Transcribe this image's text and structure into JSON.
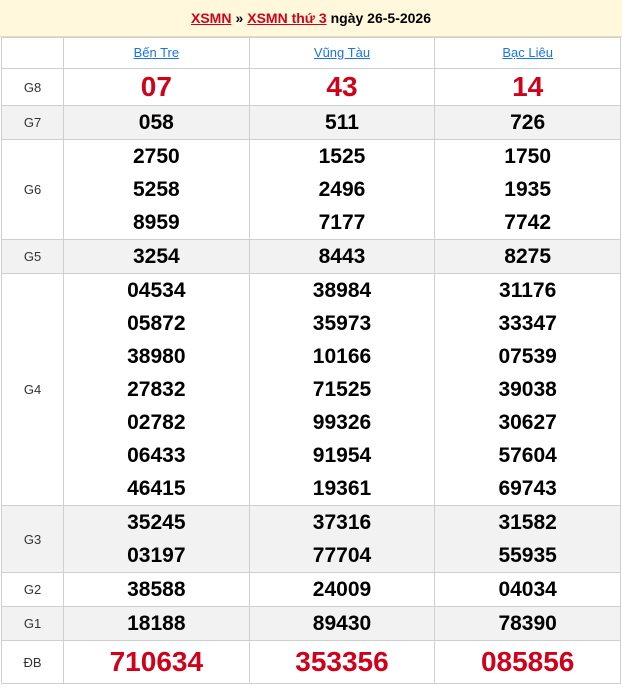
{
  "header": {
    "link1": "XSMN",
    "separator": "»",
    "link2": "XSMN thứ 3",
    "date_text": "ngày 26-5-2026"
  },
  "columns": [
    "Bến Tre",
    "Vũng Tàu",
    "Bạc Liêu"
  ],
  "prizes": [
    {
      "label": "G8",
      "values": [
        [
          "07"
        ],
        [
          "43"
        ],
        [
          "14"
        ]
      ]
    },
    {
      "label": "G7",
      "values": [
        [
          "058"
        ],
        [
          "511"
        ],
        [
          "726"
        ]
      ]
    },
    {
      "label": "G6",
      "values": [
        [
          "2750",
          "5258",
          "8959"
        ],
        [
          "1525",
          "2496",
          "7177"
        ],
        [
          "1750",
          "1935",
          "7742"
        ]
      ]
    },
    {
      "label": "G5",
      "values": [
        [
          "3254"
        ],
        [
          "8443"
        ],
        [
          "8275"
        ]
      ]
    },
    {
      "label": "G4",
      "values": [
        [
          "04534",
          "05872",
          "38980",
          "27832",
          "02782",
          "06433",
          "46415"
        ],
        [
          "38984",
          "35973",
          "10166",
          "71525",
          "99326",
          "91954",
          "19361"
        ],
        [
          "31176",
          "33347",
          "07539",
          "39038",
          "30627",
          "57604",
          "69743"
        ]
      ]
    },
    {
      "label": "G3",
      "values": [
        [
          "35245",
          "03197"
        ],
        [
          "37316",
          "77704"
        ],
        [
          "31582",
          "55935"
        ]
      ]
    },
    {
      "label": "G2",
      "values": [
        [
          "38588"
        ],
        [
          "24009"
        ],
        [
          "04034"
        ]
      ]
    },
    {
      "label": "G1",
      "values": [
        [
          "18188"
        ],
        [
          "89430"
        ],
        [
          "78390"
        ]
      ]
    },
    {
      "label": "ĐB",
      "values": [
        [
          "710634"
        ],
        [
          "353356"
        ],
        [
          "085856"
        ]
      ]
    }
  ]
}
